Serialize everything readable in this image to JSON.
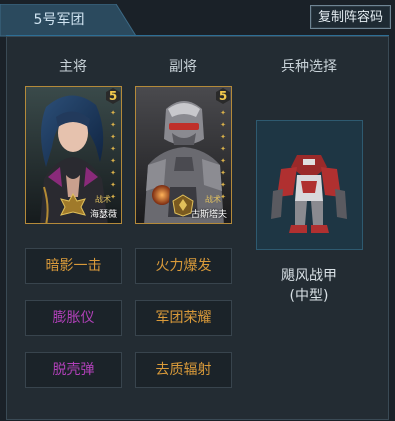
{
  "tab": {
    "label": "5号军团"
  },
  "toolbar": {
    "copy_label": "复制阵容码"
  },
  "columns": {
    "main_general": "主将",
    "vice_general": "副将",
    "troop_select": "兵种选择"
  },
  "heroes": [
    {
      "name": "海瑟薇",
      "stars": "5",
      "tactic_label": "战术"
    },
    {
      "name": "古斯塔夫",
      "stars": "5",
      "tactic_label": "战术"
    }
  ],
  "troop": {
    "name_line1": "飓风战甲",
    "name_line2": "(中型)"
  },
  "skills": {
    "main": [
      {
        "label": "暗影一击",
        "color": "#d99a3a"
      },
      {
        "label": "膨胀仪",
        "color": "#b040b8"
      },
      {
        "label": "脱壳弹",
        "color": "#b040b8"
      }
    ],
    "vice": [
      {
        "label": "火力爆发",
        "color": "#d99a3a"
      },
      {
        "label": "军团荣耀",
        "color": "#d99a3a"
      },
      {
        "label": "去质辐射",
        "color": "#d99a3a"
      }
    ]
  },
  "colors": {
    "background": "#1a2128",
    "panel": "#232c33",
    "accent_blue": "#2d6e95",
    "card_border_gold": "#b48a3a"
  }
}
